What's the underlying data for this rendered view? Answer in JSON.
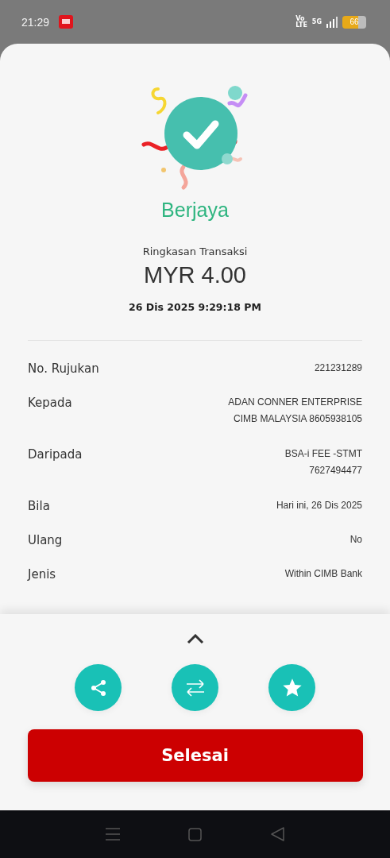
{
  "status_bar": {
    "time": "21:29",
    "network_top": "Vo",
    "network_bottom": "LTE",
    "signal_type": "5G",
    "battery": "66"
  },
  "result": {
    "status": "Berjaya",
    "summary_title": "Ringkasan Transaksi",
    "currency": "MYR",
    "amount": "4.00",
    "datetime": "26 Dis 2025 9:29:18 PM"
  },
  "details": [
    {
      "label": "No. Rujukan",
      "values": [
        "221231289"
      ]
    },
    {
      "label": "Kepada",
      "values": [
        "ADAN CONNER ENTERPRISE",
        "CIMB MALAYSIA 8605938105"
      ]
    },
    {
      "label": "Daripada",
      "values": [
        "BSA-i FEE -STMT",
        "7627494477"
      ]
    },
    {
      "label": "Bila",
      "values": [
        "Hari ini, 26 Dis 2025"
      ]
    },
    {
      "label": "Ulang",
      "values": [
        "No"
      ]
    },
    {
      "label": "Jenis",
      "values": [
        "Within CIMB Bank"
      ]
    }
  ],
  "actions": [
    {
      "kind": "share"
    },
    {
      "kind": "transfer"
    },
    {
      "kind": "favourite"
    }
  ],
  "done_button": "Selesai",
  "nav_bar": [
    {
      "kind": "menu"
    },
    {
      "kind": "home"
    },
    {
      "kind": "back"
    }
  ]
}
